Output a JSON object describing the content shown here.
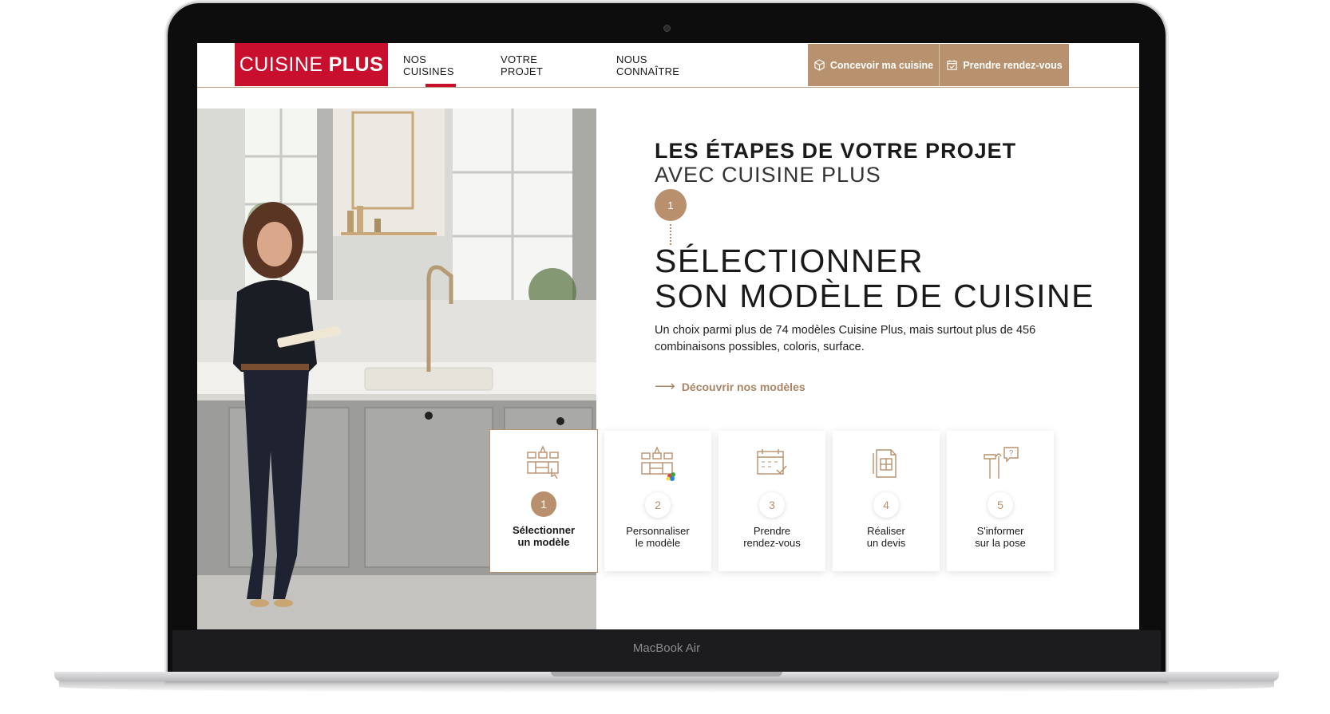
{
  "device": {
    "label": "MacBook Air"
  },
  "brand": {
    "name_regular": "CUISINE",
    "name_bold": "PLUS",
    "color": "#c8102e"
  },
  "nav": {
    "items": [
      {
        "label": "NOS CUISINES",
        "active": true
      },
      {
        "label": "VOTRE PROJET",
        "active": false
      },
      {
        "label": "NOUS CONNAÎTRE",
        "active": false
      }
    ]
  },
  "header_buttons": {
    "design": {
      "label": "Concevoir ma cuisine",
      "icon": "cube-icon"
    },
    "appointment": {
      "label": "Prendre rendez-vous",
      "icon": "calendar-check-icon"
    }
  },
  "accent_color": "#b9906d",
  "hero": {
    "title": "LES ÉTAPES DE VOTRE PROJET",
    "subtitle": "AVEC CUISINE PLUS",
    "step_number": "1",
    "heading_line1": "SÉLECTIONNER",
    "heading_line2": "SON MODÈLE DE CUISINE",
    "description": "Un choix parmi plus de 74 modèles Cuisine Plus, mais surtout plus de 456 combinaisons possibles, coloris, surface.",
    "link_label": "Découvrir nos modèles"
  },
  "steps": [
    {
      "number": "1",
      "line1": "Sélectionner",
      "line2": "un modèle",
      "icon": "kitchen-select-icon",
      "active": true
    },
    {
      "number": "2",
      "line1": "Personnaliser",
      "line2": "le modèle",
      "icon": "kitchen-color-icon",
      "active": false
    },
    {
      "number": "3",
      "line1": "Prendre",
      "line2": "rendez-vous",
      "icon": "calendar-icon",
      "active": false
    },
    {
      "number": "4",
      "line1": "Réaliser",
      "line2": "un devis",
      "icon": "quote-document-icon",
      "active": false
    },
    {
      "number": "5",
      "line1": "S'informer",
      "line2": "sur la pose",
      "icon": "tools-question-icon",
      "active": false
    }
  ]
}
